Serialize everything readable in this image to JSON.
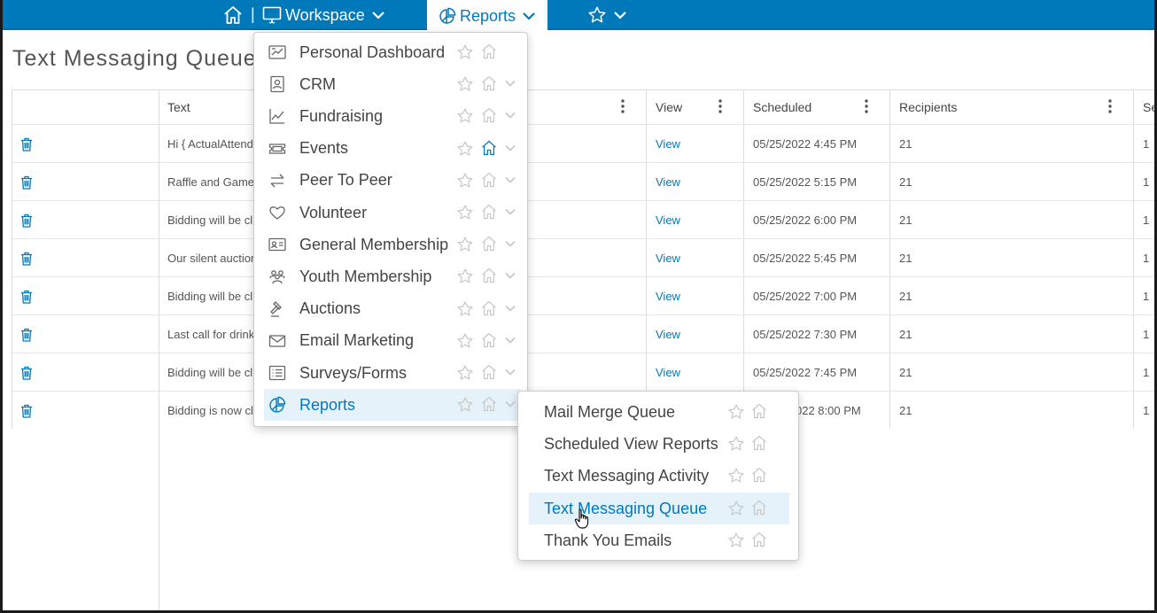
{
  "nav": {
    "separator": "|",
    "workspace_label": "Workspace",
    "reports_label": "Reports",
    "bar_color": "#0079bb"
  },
  "page": {
    "title": "Text Messaging Queue"
  },
  "table": {
    "headers": [
      "Text",
      "View",
      "Scheduled",
      "Recipients",
      "Se"
    ],
    "rows": [
      {
        "text": "Hi { ActualAttendee",
        "view": "View",
        "scheduled": "05/25/2022 4:45 PM",
        "recipients": "21",
        "last": "1"
      },
      {
        "text": "Raffle and Game",
        "view": "View",
        "scheduled": "05/25/2022 5:15 PM",
        "recipients": "21",
        "last": "1"
      },
      {
        "text": "Bidding will be cl",
        "view": "View",
        "scheduled": "05/25/2022 6:00 PM",
        "recipients": "21",
        "last": "1"
      },
      {
        "text": "Our silent auction",
        "view": "View",
        "scheduled": "05/25/2022 5:45 PM",
        "recipients": "21",
        "last": "1"
      },
      {
        "text": "Bidding will be cl",
        "view": "View",
        "scheduled": "05/25/2022 7:00 PM",
        "recipients": "21",
        "last": "1"
      },
      {
        "text": "Last call for drink",
        "view": "View",
        "scheduled": "05/25/2022 7:30 PM",
        "recipients": "21",
        "last": "1"
      },
      {
        "text": "Bidding will be cl",
        "view": "View",
        "scheduled": "05/25/2022 7:45 PM",
        "recipients": "21",
        "last": "1"
      },
      {
        "text": "Bidding is now cl",
        "view": "",
        "scheduled": "022 8:00 PM",
        "recipients": "21",
        "last": "1"
      }
    ]
  },
  "menu": {
    "items": [
      {
        "label": "Personal Dashboard",
        "icon": "dashboard-icon",
        "chevron": false,
        "home_active": false
      },
      {
        "label": "CRM",
        "icon": "contact-card-icon",
        "chevron": true,
        "home_active": false
      },
      {
        "label": "Fundraising",
        "icon": "line-chart-icon",
        "chevron": true,
        "home_active": false
      },
      {
        "label": "Events",
        "icon": "ticket-icon",
        "chevron": true,
        "home_active": true
      },
      {
        "label": "Peer To Peer",
        "icon": "arrows-exchange-icon",
        "chevron": true,
        "home_active": false
      },
      {
        "label": "Volunteer",
        "icon": "heart-icon",
        "chevron": true,
        "home_active": false
      },
      {
        "label": "General Membership",
        "icon": "id-card-icon",
        "chevron": true,
        "home_active": false
      },
      {
        "label": "Youth Membership",
        "icon": "people-icon",
        "chevron": true,
        "home_active": false
      },
      {
        "label": "Auctions",
        "icon": "gavel-icon",
        "chevron": true,
        "home_active": false
      },
      {
        "label": "Email Marketing",
        "icon": "envelope-icon",
        "chevron": true,
        "home_active": false
      },
      {
        "label": "Surveys/Forms",
        "icon": "list-icon",
        "chevron": true,
        "home_active": false
      },
      {
        "label": "Reports",
        "icon": "pie-chart-icon",
        "chevron": true,
        "home_active": false
      }
    ]
  },
  "submenu": {
    "items": [
      {
        "label": "Mail Merge Queue"
      },
      {
        "label": "Scheduled View Reports"
      },
      {
        "label": "Text Messaging Activity"
      },
      {
        "label": "Text Messaging Queue"
      },
      {
        "label": "Thank You Emails"
      }
    ]
  }
}
